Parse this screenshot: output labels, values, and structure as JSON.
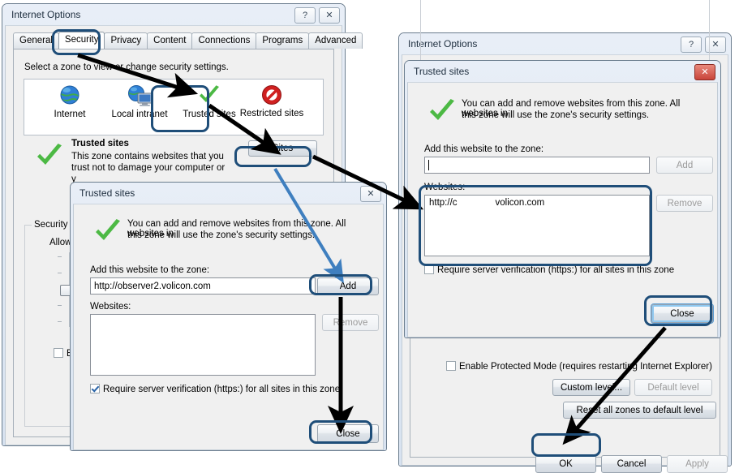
{
  "background": "#ffffff",
  "colors": {
    "annotation_highlight": "#1f4e79",
    "annotation_arrow_black": "#000000",
    "annotation_arrow_blue": "#3f7fbf",
    "window_face": "#f0f0f0",
    "title_gradient_top": "#e8eef7",
    "close_red": "#c9443a",
    "check_green": "#4cb944",
    "focus_blue": "#8fc8f0"
  },
  "left_window": {
    "title": "Internet Options",
    "titlebar_buttons": [
      {
        "name": "help-button",
        "glyph": "?"
      },
      {
        "name": "close-button",
        "glyph": "✕"
      }
    ],
    "tabs": [
      {
        "label": "General",
        "active": false
      },
      {
        "label": "Security",
        "active": true
      },
      {
        "label": "Privacy",
        "active": false
      },
      {
        "label": "Content",
        "active": false
      },
      {
        "label": "Connections",
        "active": false
      },
      {
        "label": "Programs",
        "active": false
      },
      {
        "label": "Advanced",
        "active": false
      }
    ],
    "zone_prompt": "Select a zone to view or change security settings.",
    "zones": [
      {
        "label": "Internet",
        "icon": "globe-icon",
        "selected": false
      },
      {
        "label": "Local intranet",
        "icon": "globe-monitor-icon",
        "selected": false
      },
      {
        "label": "Trusted sites",
        "icon": "green-check-icon",
        "selected": true
      },
      {
        "label": "Restricted sites",
        "icon": "red-no-entry-icon",
        "selected": false
      }
    ],
    "zone_detail": {
      "name": "Trusted sites",
      "description_line1": "This zone contains websites that you",
      "description_line2": "trust not to damage your computer or",
      "description_line3": "y",
      "sites_button": "Sites"
    },
    "security_group": {
      "legend": "Security l",
      "allowed_label": "Allowed",
      "enable_checkbox_label": "En",
      "enable_checked": false
    }
  },
  "middle_dialog": {
    "title": "Trusted sites",
    "close_glyph": "✕",
    "info_line1": "You can add and remove websites from this zone. All websites in",
    "info_line2": "this zone will use the zone's security settings.",
    "add_label": "Add this website to the zone:",
    "url_value": "http://observer2.volicon.com",
    "add_button": "Add",
    "websites_label": "Websites:",
    "websites": [],
    "remove_button": "Remove",
    "remove_disabled": true,
    "require_verification_label": "Require server verification (https:) for all sites in this zone",
    "require_verification_checked": true,
    "close_button": "Close"
  },
  "right_window": {
    "title": "Internet Options",
    "titlebar_buttons": [
      {
        "name": "help-button",
        "glyph": "?"
      },
      {
        "name": "close-button",
        "glyph": "✕"
      }
    ],
    "protected_mode": {
      "label": "Enable Protected Mode (requires restarting Internet Explorer)",
      "checked": false
    },
    "custom_level_button": "Custom level...",
    "default_level_button": "Default level",
    "default_level_disabled": true,
    "reset_button": "Reset all zones to default level",
    "footer_buttons": [
      {
        "label": "OK",
        "name": "ok-button",
        "disabled": false,
        "highlighted": true
      },
      {
        "label": "Cancel",
        "name": "cancel-button",
        "disabled": false,
        "highlighted": false
      },
      {
        "label": "Apply",
        "name": "apply-button",
        "disabled": true,
        "highlighted": false
      }
    ]
  },
  "right_dialog": {
    "title": "Trusted sites",
    "close_glyph": "✕",
    "info_line1": "You can add and remove websites from this zone. All websites in",
    "info_line2": "this zone will use the zone's security settings.",
    "add_label": "Add this website to the zone:",
    "url_value": "",
    "url_caret": true,
    "add_button": "Add",
    "add_disabled": true,
    "websites_label": "Websites:",
    "websites": [
      {
        "prefix": "http://c",
        "redacted": true,
        "suffix": "volicon.com"
      }
    ],
    "remove_button": "Remove",
    "remove_disabled": true,
    "require_verification_label": "Require server verification (https:) for all sites in this zone",
    "require_verification_checked": false,
    "close_button": "Close",
    "close_focused": true
  },
  "annotations": {
    "highlights": [
      {
        "name": "highlight-security-tab"
      },
      {
        "name": "highlight-trusted-sites-zone"
      },
      {
        "name": "highlight-sites-button"
      },
      {
        "name": "highlight-add-button"
      },
      {
        "name": "highlight-middle-close-button"
      },
      {
        "name": "highlight-websites-list"
      },
      {
        "name": "highlight-right-close-button"
      },
      {
        "name": "highlight-ok-button"
      }
    ],
    "arrows": [
      {
        "name": "arrow-security-tab-to-trusted-zone",
        "color": "#000000"
      },
      {
        "name": "arrow-trusted-zone-to-sites-button",
        "color": "#000000"
      },
      {
        "name": "arrow-sites-button-to-right-dialog",
        "color": "#000000"
      },
      {
        "name": "arrow-sites-to-add-button",
        "color": "#3f7fbf"
      },
      {
        "name": "arrow-add-to-close-button",
        "color": "#000000"
      },
      {
        "name": "arrow-right-close-to-ok",
        "color": "#000000"
      }
    ]
  }
}
